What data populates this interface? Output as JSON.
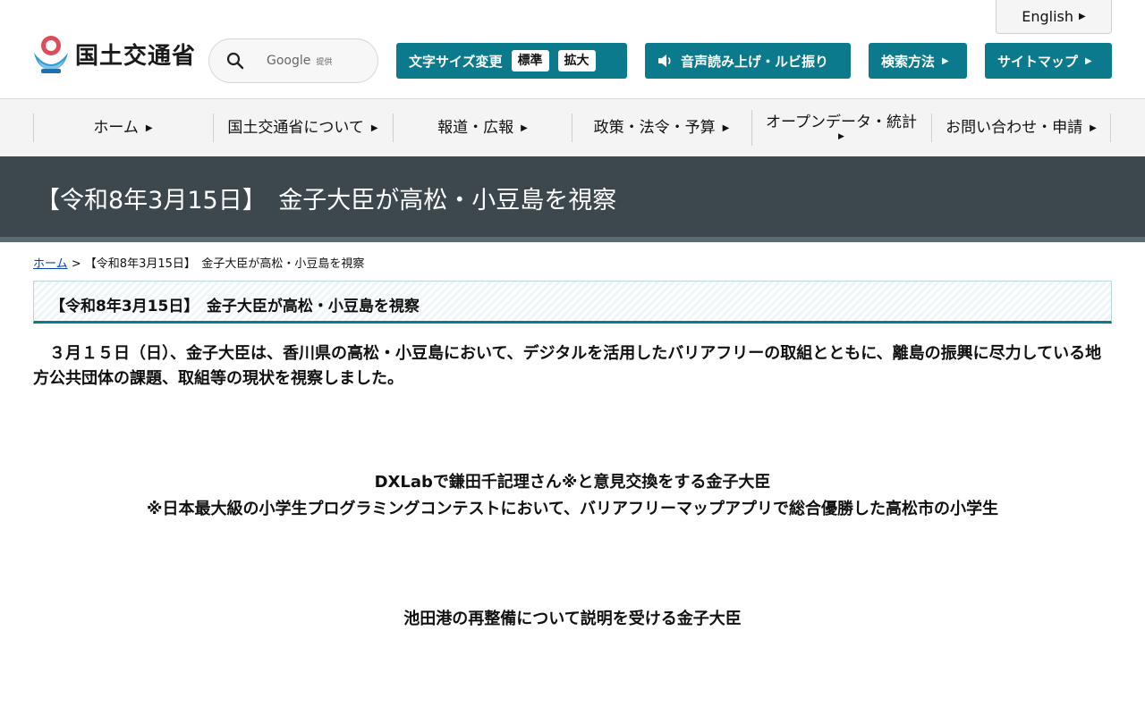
{
  "header": {
    "english_label": "English",
    "logo_text": "国土交通省",
    "search": {
      "google_label": "Google",
      "provided_label": "提供"
    },
    "font_size": {
      "label": "文字サイズ変更",
      "standard": "標準",
      "large": "拡大"
    },
    "speech_label": "音声読み上げ・ルビ振り",
    "search_method_label": "検索方法",
    "sitemap_label": "サイトマップ"
  },
  "nav": {
    "items": [
      {
        "label": "ホーム"
      },
      {
        "label": "国土交通省について"
      },
      {
        "label": "報道・広報"
      },
      {
        "label": "政策・法令・予算"
      },
      {
        "label": "オープンデータ・統計"
      },
      {
        "label": "お問い合わせ・申請"
      }
    ]
  },
  "page": {
    "title": "【令和8年3月15日】　金子大臣が高松・小豆島を視察",
    "breadcrumb": {
      "home": "ホーム",
      "separator": " > ",
      "current": "【令和8年3月15日】　金子大臣が高松・小豆島を視察"
    },
    "heading": "【令和8年3月15日】　金子大臣が高松・小豆島を視察",
    "lead": "　３月１５日（日）、金子大臣は、香川県の高松・小豆島において、デジタルを活用したバリアフリーの取組とともに、離島の振興に尽力している地方公共団体の課題、取組等の現状を視察しました。",
    "caption1_line1": "DXLabで鎌田千記理さん※と意見交換をする金子大臣",
    "caption1_line2": "※日本最大級の小学生プログラミングコンテストにおいて、バリアフリーマップアプリで総合優勝した高松市の小学生",
    "caption2": "池田港の再整備について説明を受ける金子大臣"
  },
  "colors": {
    "accent": "#0a7a8c",
    "banner": "#3c484e",
    "nav_bg": "#f4f4f4",
    "link": "#0645ad"
  },
  "icons": {
    "logo": "mlit-logo-icon",
    "search": "search-icon",
    "speaker": "speaker-icon",
    "arrow": "triangle-right-icon"
  }
}
